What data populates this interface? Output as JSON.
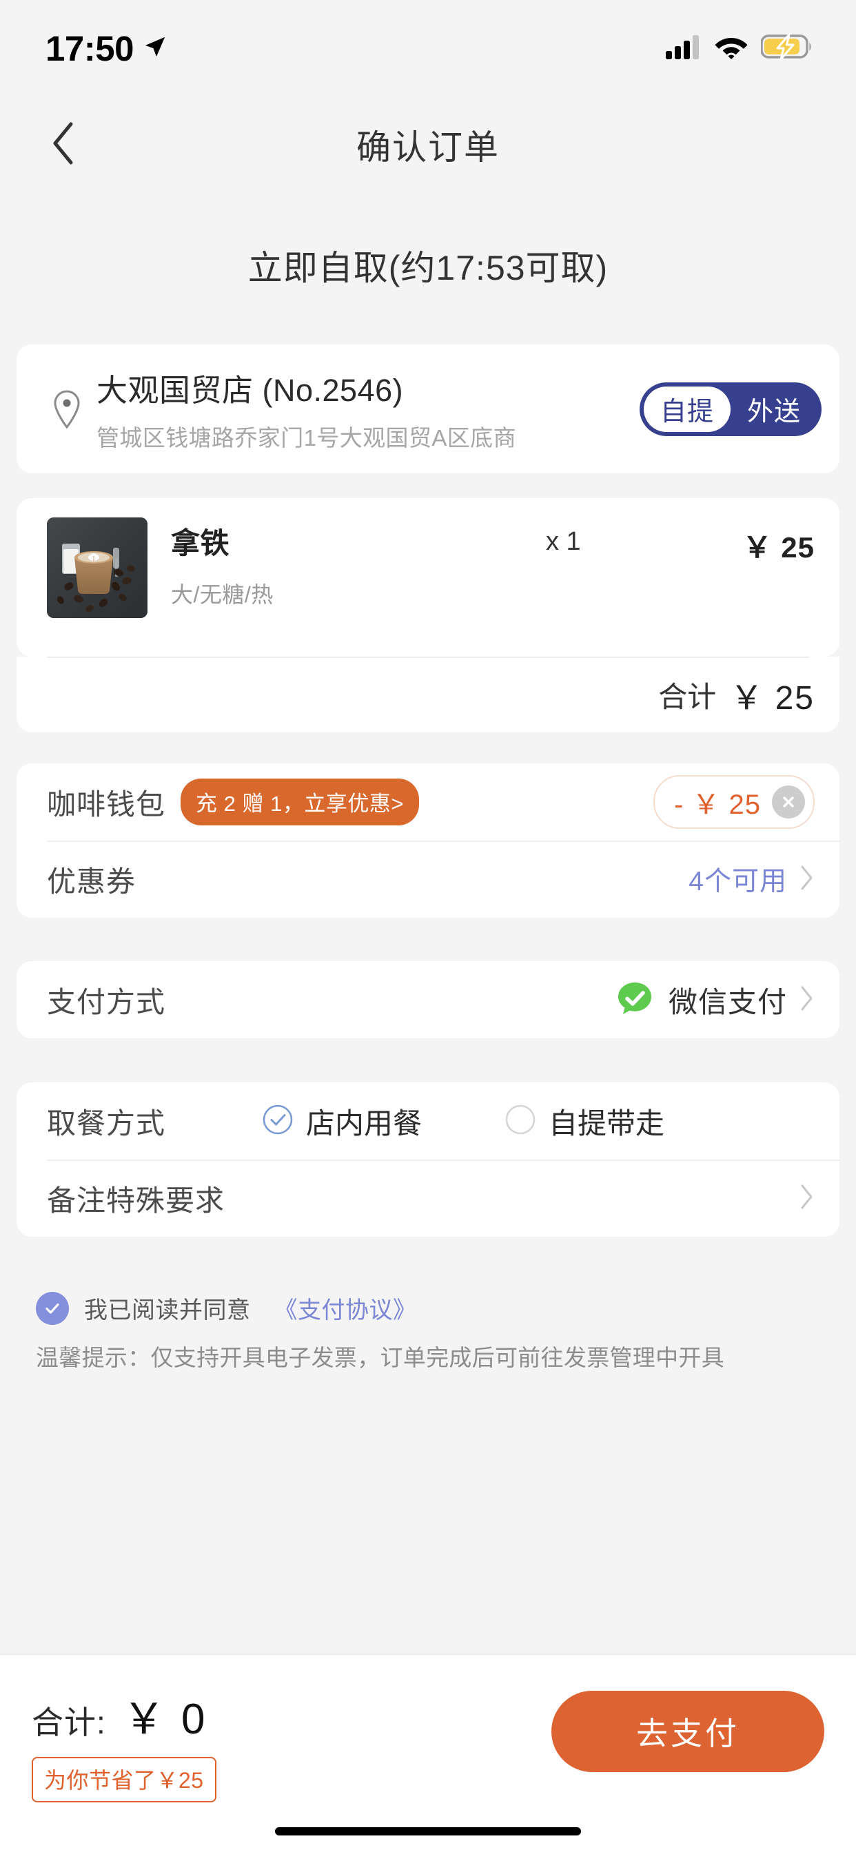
{
  "status_bar": {
    "time": "17:50",
    "location_icon": "location-arrow-icon",
    "signal_icon": "cellular-signal-icon",
    "wifi_icon": "wifi-icon",
    "battery_icon": "battery-charging-icon"
  },
  "nav": {
    "back_icon": "chevron-left-icon",
    "title": "确认订单"
  },
  "pickup": {
    "text": "立即自取(约17:53可取)"
  },
  "store": {
    "pin_icon": "map-pin-icon",
    "name": "大观国贸店 (No.2546)",
    "address": "管城区钱塘路乔家门1号大观国贸A区底商",
    "modes": [
      {
        "label": "自提",
        "selected": true
      },
      {
        "label": "外送",
        "selected": false
      }
    ],
    "toggle_bg_color": "#373F8F"
  },
  "product": {
    "image_alt": "latte-glass-with-coffee-beans",
    "name": "拿铁",
    "spec": "大/无糖/热",
    "quantity": "x 1",
    "price": "￥ 25"
  },
  "subtotal": {
    "label": "合计",
    "value": "￥ 25"
  },
  "wallet": {
    "label": "咖啡钱包",
    "promo_badge": "充 2 赠 1，立享优惠>",
    "discount": "- ￥ 25",
    "close_icon": "close-circle-icon",
    "badge_color": "#D9682C",
    "discount_color": "#E0602E"
  },
  "coupon": {
    "label": "优惠券",
    "value": "4个可用",
    "chevron_icon": "chevron-right-icon",
    "value_color": "#7B86D4"
  },
  "payment": {
    "label": "支付方式",
    "icon": "wechat-pay-check-icon",
    "value": "微信支付",
    "chevron_icon": "chevron-right-icon",
    "icon_color": "#5ECB4E"
  },
  "dining": {
    "label": "取餐方式",
    "options": [
      {
        "label": "店内用餐",
        "selected": true,
        "icon": "radio-checked-icon"
      },
      {
        "label": "自提带走",
        "selected": false,
        "icon": "radio-unchecked-icon"
      }
    ],
    "selected_color": "#6E8FD0"
  },
  "remarks": {
    "label": "备注特殊要求",
    "chevron_icon": "chevron-right-icon"
  },
  "agreement": {
    "checkbox_icon": "checkbox-checked-icon",
    "text": "我已阅读并同意",
    "link": "《支付协议》",
    "checkbox_color": "#8490DD",
    "link_color": "#7B86D4"
  },
  "notice": {
    "text": "温馨提示：仅支持开具电子发票，订单完成后可前往发票管理中开具"
  },
  "bottom_bar": {
    "total_label": "合计:",
    "total_value": "￥ 0",
    "savings_badge": "为你节省了￥25",
    "pay_button": "去支付",
    "pay_button_color": "#DD6333",
    "savings_color": "#E0602E"
  }
}
